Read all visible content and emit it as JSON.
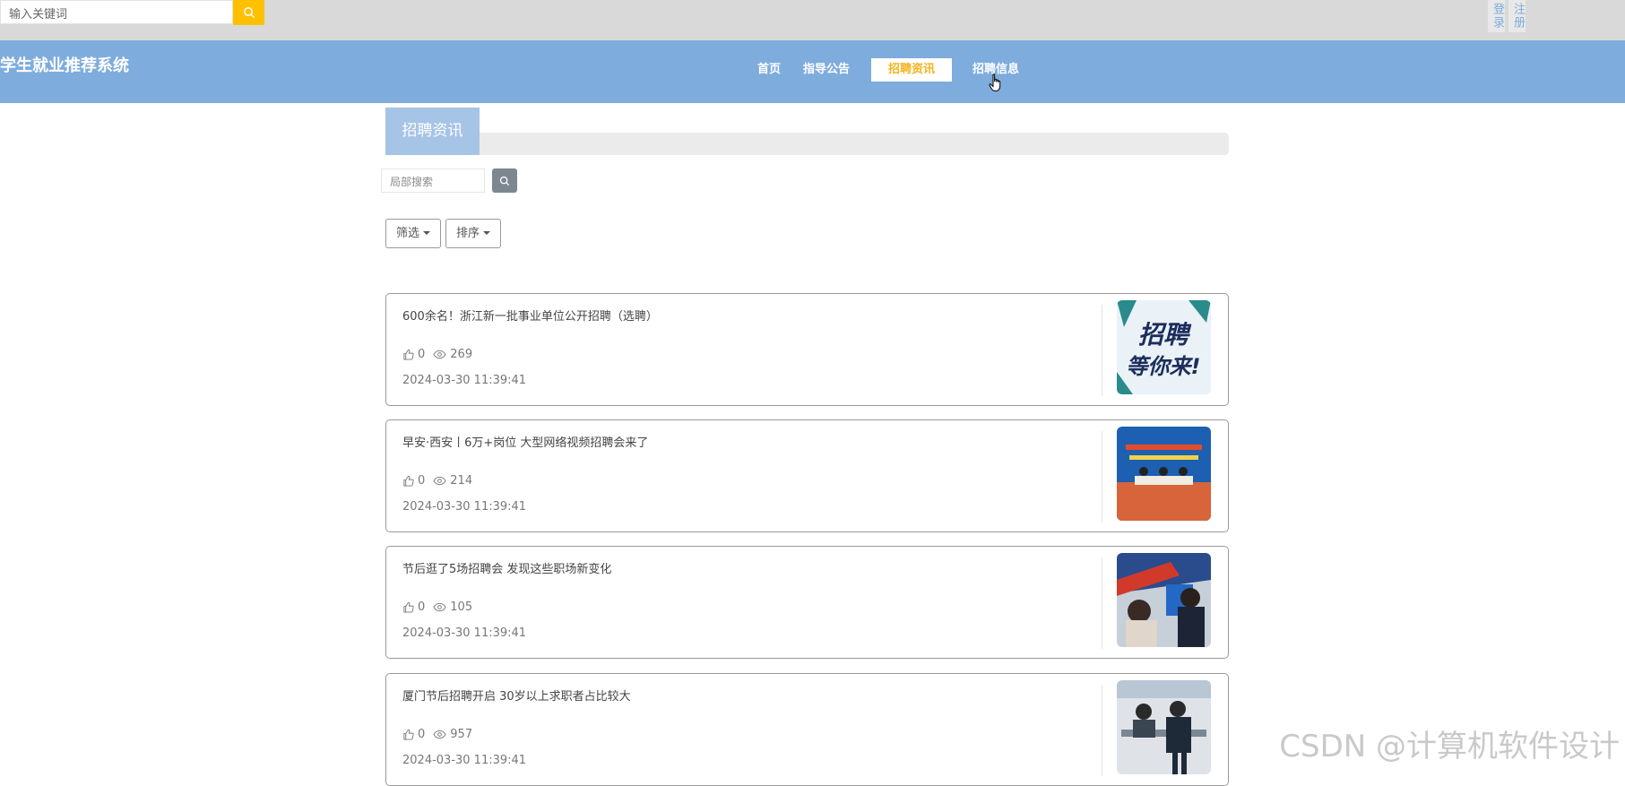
{
  "topbar": {
    "search_placeholder": "输入关键词",
    "login_label": "登录",
    "register_label": "注册"
  },
  "navbar": {
    "brand": "学生就业推荐系统",
    "items": [
      {
        "label": "首页"
      },
      {
        "label": "指导公告"
      },
      {
        "label": "招聘资讯",
        "active": true
      },
      {
        "label": "招聘信息"
      }
    ]
  },
  "section": {
    "title": "招聘资讯",
    "local_search_placeholder": "局部搜索",
    "filter_label": "筛选",
    "sort_label": "排序"
  },
  "articles": [
    {
      "title": "600余名！浙江新一批事业单位公开招聘（选聘）",
      "likes": "0",
      "views": "269",
      "time": "2024-03-30 11:39:41",
      "thumb_text": "招聘等你来!"
    },
    {
      "title": "早安·西安丨6万+岗位 大型网络视频招聘会来了",
      "likes": "0",
      "views": "214",
      "time": "2024-03-30 11:39:41"
    },
    {
      "title": "节后逛了5场招聘会 发现这些职场新变化",
      "likes": "0",
      "views": "105",
      "time": "2024-03-30 11:39:41"
    },
    {
      "title": "厦门节后招聘开启 30岁以上求职者占比较大",
      "likes": "0",
      "views": "957",
      "time": "2024-03-30 11:39:41"
    }
  ],
  "watermark": "CSDN @计算机软件设计"
}
